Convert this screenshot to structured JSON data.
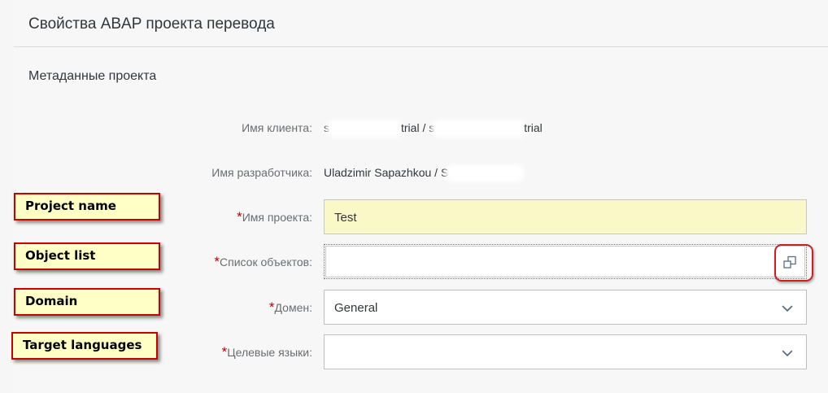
{
  "header": {
    "title": "Свойства ABAP проекта перевода"
  },
  "section": {
    "title": "Метаданные проекта"
  },
  "fields": {
    "client": {
      "label": "Имя клиента:",
      "value_part1": "s",
      "value_part2": "trial / s",
      "value_part3": "trial"
    },
    "developer": {
      "label": "Имя разработчика:",
      "value": "Uladzimir Sapazhkou / S"
    },
    "project_name": {
      "required_mark": "*",
      "label": "Имя проекта:",
      "value": "Test"
    },
    "object_list": {
      "required_mark": "*",
      "label": "Список объектов:",
      "value": "",
      "icon": "value-help-icon"
    },
    "domain": {
      "required_mark": "*",
      "label": "Домен:",
      "value": "General",
      "icon": "chevron-down-icon"
    },
    "target_languages": {
      "required_mark": "*",
      "label": "Целевые языки:",
      "value": "",
      "icon": "chevron-down-icon"
    }
  },
  "callouts": {
    "project_name": "Project name",
    "object_list": "Object list",
    "domain": "Domain",
    "target_languages": "Target languages"
  },
  "colors": {
    "required": "#bb0000",
    "highlight_field": "#fbf8c8",
    "callout_bg": "#ffffc6",
    "callout_border": "#c80000"
  }
}
